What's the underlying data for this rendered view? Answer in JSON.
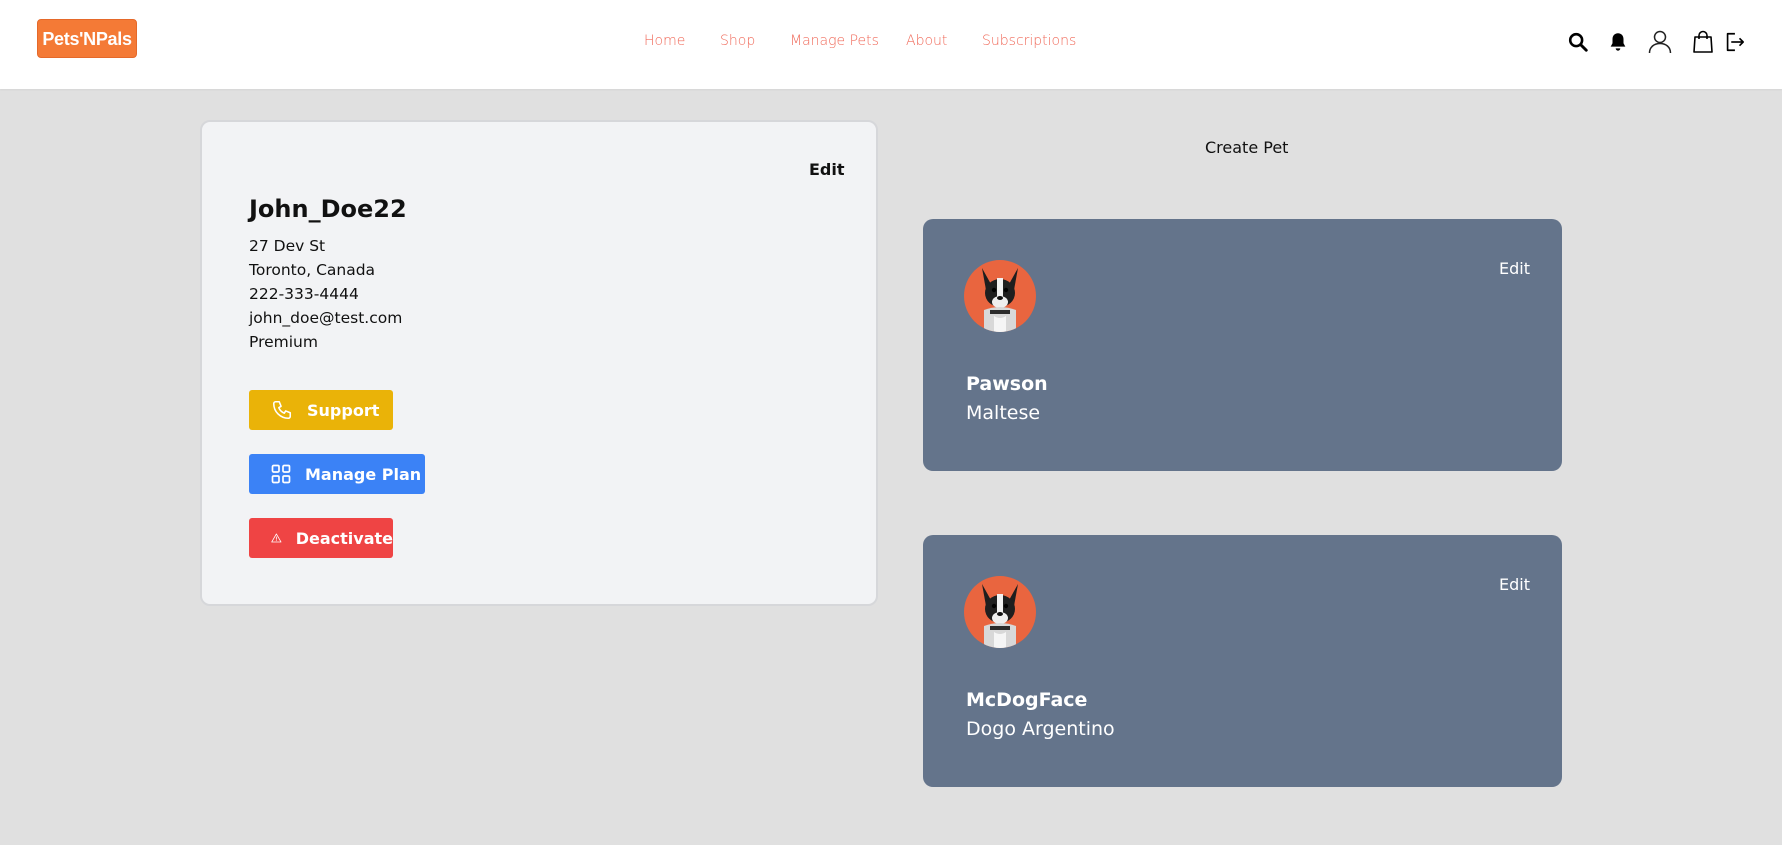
{
  "header": {
    "logo": "Pets'NPals",
    "nav": [
      {
        "label": "Home"
      },
      {
        "label": "Shop"
      },
      {
        "label": "Manage Pets"
      },
      {
        "label": "About"
      },
      {
        "label": "Subscriptions"
      }
    ],
    "icons": [
      "search-icon",
      "bell-icon",
      "user-icon",
      "shopping-bag-icon",
      "logout-icon"
    ]
  },
  "profile": {
    "edit_label": "Edit",
    "username": "John_Doe22",
    "street": "27 Dev St",
    "city": "Toronto, Canada",
    "phone": "222-333-4444",
    "email": "john_doe@test.com",
    "plan": "Premium",
    "buttons": {
      "support": "Support",
      "manage_plan": "Manage Plan",
      "deactivate": "Deactivate"
    }
  },
  "pets_panel": {
    "create_label": "Create Pet",
    "pets": [
      {
        "name": "Pawson",
        "breed": "Maltese",
        "edit_label": "Edit"
      },
      {
        "name": "McDogFace",
        "breed": "Dogo Argentino",
        "edit_label": "Edit"
      }
    ]
  },
  "colors": {
    "brand": "#f47a36",
    "nav_link": "#f06a5a",
    "support": "#eab308",
    "manage_plan": "#3b82f6",
    "deactivate": "#ef4444",
    "pet_card": "#64748b"
  }
}
